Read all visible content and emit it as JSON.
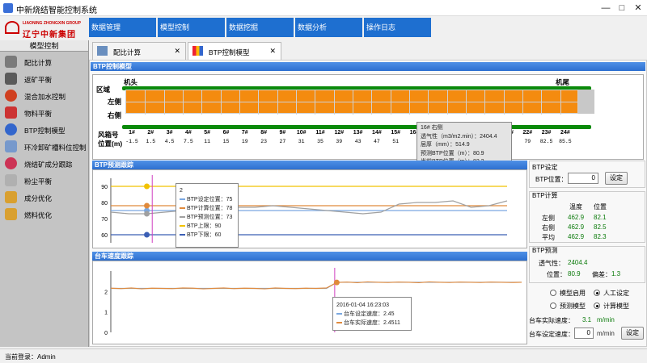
{
  "window": {
    "title": "中新烧结智能控制系统",
    "min": "—",
    "max": "□",
    "close": "✕"
  },
  "logo": {
    "en": "LIAONING ZHONGXIN GROUP",
    "cn": "辽宁中新集团"
  },
  "top_menu": [
    "数据管理",
    "模型控制",
    "数据挖掘",
    "数据分析",
    "操作日志"
  ],
  "sidebar": {
    "header": "模型控制",
    "items": [
      {
        "label": "配比计算",
        "icon": "mix-icon",
        "color": "#7a7a7a"
      },
      {
        "label": "返矿平衡",
        "icon": "balance-icon",
        "color": "#5a5a5a"
      },
      {
        "label": "混合加水控制",
        "icon": "water-icon",
        "color": "#d04020"
      },
      {
        "label": "物料平衡",
        "icon": "material-icon",
        "color": "#cc3333"
      },
      {
        "label": "BTP控制模型",
        "icon": "compass-icon",
        "color": "#3366cc"
      },
      {
        "label": "环冷卸矿槽料位控制",
        "icon": "level-icon",
        "color": "#7799cc"
      },
      {
        "label": "烧结矿成分跟踪",
        "icon": "pie-icon",
        "color": "#cc3355"
      },
      {
        "label": "粉尘平衡",
        "icon": "dust-icon",
        "color": "#b0b0b0"
      },
      {
        "label": "成分优化",
        "icon": "clipboard-icon",
        "color": "#d9a030"
      },
      {
        "label": "燃料优化",
        "icon": "clipboard-icon",
        "color": "#d9a030"
      }
    ]
  },
  "tabs": [
    {
      "label": "配比计算",
      "close": "✕"
    },
    {
      "label": "BTP控制模型",
      "close": "✕"
    }
  ],
  "btp_model": {
    "title": "BTP控制模型",
    "row_label": "区域",
    "head_label": "机头",
    "tail_label": "机尾",
    "left_label": "左侧",
    "right_label": "右侧",
    "box_label": "风箱号",
    "pos_label": "位置(m)",
    "boxes": [
      "1#",
      "2#",
      "3#",
      "4#",
      "5#",
      "6#",
      "7#",
      "8#",
      "9#",
      "10#",
      "11#",
      "12#",
      "13#",
      "14#",
      "15#",
      "16#",
      "17#",
      "18#",
      "19#",
      "20#",
      "21#",
      "22#",
      "23#",
      "24#"
    ],
    "positions": [
      "-1.5",
      "1.5",
      "4.5",
      "7.5",
      "11",
      "15",
      "19",
      "23",
      "27",
      "31",
      "35",
      "39",
      "43",
      "47",
      "51",
      "",
      "",
      "",
      "",
      "",
      "",
      "79",
      "82.5",
      "85.5"
    ],
    "tooltip": {
      "title": "16# 右侧",
      "lines": [
        "透气性（m3/m2.min）：2404.4",
        "层厚（mm）：514.9",
        "预测BTP位置（m）：80.9",
        "当前BTP位置（m）：82.2",
        "预测偏差（m）：1.3"
      ]
    }
  },
  "btp_trace": {
    "title": "BTP预测跟踪",
    "tooltip": {
      "header": "2",
      "lines": [
        "BTP设定位置：75",
        "BTP计算位置：78",
        "BTP预测位置：73",
        "BTP上限：90",
        "BTP下限：60"
      ]
    }
  },
  "speed_trace": {
    "title": "台车速度跟踪",
    "tooltip": {
      "header": "2016-01-04 16:23:03",
      "lines": [
        "台车设定速度：2.45",
        "台车实际速度：2.4511"
      ]
    }
  },
  "chart_data": [
    {
      "type": "line",
      "title": "BTP预测跟踪",
      "ylim": [
        55,
        95
      ],
      "yticks": [
        "90",
        "80",
        "70",
        "60"
      ],
      "x": [
        0,
        1,
        2,
        3,
        4,
        5,
        6,
        7,
        8,
        9,
        10,
        11,
        12,
        13,
        14,
        15,
        16,
        17,
        18,
        19,
        20,
        21,
        22
      ],
      "series": [
        {
          "name": "BTP设定位置",
          "color": "#7aa7e0",
          "values": [
            75,
            75,
            75,
            75,
            75,
            75,
            75,
            75,
            75,
            75,
            75,
            75,
            75,
            75,
            75,
            75,
            75,
            75,
            75,
            75,
            75,
            75,
            75
          ]
        },
        {
          "name": "BTP计算位置",
          "color": "#e08a3c",
          "values": [
            78,
            78,
            78,
            78,
            78,
            78,
            78,
            78,
            78,
            78,
            78,
            78,
            78,
            78,
            78,
            78,
            78,
            78,
            78,
            78,
            78,
            78,
            78
          ]
        },
        {
          "name": "BTP预测位置",
          "color": "#a0a0a0",
          "values": [
            74,
            73,
            73,
            74,
            75,
            76,
            76,
            77,
            77,
            78,
            77,
            76,
            75,
            74,
            73,
            74,
            79,
            80,
            80,
            81,
            77,
            78,
            81
          ]
        },
        {
          "name": "BTP上限",
          "color": "#f2c200",
          "values": [
            90,
            90,
            90,
            90,
            90,
            90,
            90,
            90,
            90,
            90,
            90,
            90,
            90,
            90,
            90,
            90,
            90,
            90,
            90,
            90,
            90,
            90,
            90
          ]
        },
        {
          "name": "BTP下限",
          "color": "#3b5fb5",
          "values": [
            60,
            60,
            60,
            60,
            60,
            60,
            60,
            60,
            60,
            60,
            60,
            60,
            60,
            60,
            60,
            60,
            60,
            60,
            60,
            60,
            60,
            60,
            60
          ]
        }
      ]
    },
    {
      "type": "line",
      "title": "台车速度跟踪",
      "ylim": [
        0,
        3
      ],
      "yticks": [
        "2",
        "1",
        "0"
      ],
      "x": [
        0,
        1,
        2,
        3,
        4,
        5,
        6,
        7,
        8,
        9,
        10,
        11,
        12,
        13,
        14,
        15,
        16,
        17,
        18,
        19,
        20,
        21,
        22,
        23,
        24,
        25,
        26,
        27,
        28,
        29,
        30,
        31,
        32,
        33,
        34,
        35,
        36,
        37,
        38,
        39,
        40
      ],
      "series": [
        {
          "name": "台车设定速度",
          "color": "#7aa7e0",
          "values": [
            2.15,
            2.15,
            2.15,
            2.15,
            2.15,
            2.15,
            2.15,
            2.15,
            2.15,
            2.15,
            2.15,
            2.15,
            2.15,
            2.15,
            2.15,
            2.15,
            2.15,
            2.15,
            2.15,
            2.15,
            2.15,
            2.15,
            2.45,
            2.45,
            2.45,
            2.45,
            2.45,
            2.45,
            2.45,
            2.45,
            2.45,
            2.45,
            2.45,
            2.45,
            2.45,
            2.45,
            2.45,
            2.45,
            2.45,
            2.45,
            2.45
          ]
        },
        {
          "name": "台车实际速度",
          "color": "#e08a3c",
          "values": [
            2.16,
            2.14,
            2.17,
            2.13,
            2.16,
            2.15,
            2.14,
            2.17,
            2.16,
            2.13,
            2.15,
            2.17,
            2.14,
            2.16,
            2.15,
            2.13,
            2.17,
            2.15,
            2.14,
            2.16,
            2.15,
            2.17,
            2.44,
            2.46,
            2.43,
            2.47,
            2.45,
            2.44,
            2.46,
            2.45,
            2.43,
            2.47,
            2.45,
            2.44,
            2.46,
            2.45,
            2.44,
            2.46,
            2.45,
            2.44,
            2.45
          ]
        }
      ]
    }
  ],
  "right_panel": {
    "btp_setting": {
      "title": "BTP设定",
      "label": "BTP位置：",
      "value": "0",
      "button": "设定"
    },
    "btp_calc": {
      "title": "BTP计算",
      "col_temp": "温度",
      "col_pos": "位置",
      "rows": [
        {
          "label": "左侧",
          "temp": "462.9",
          "pos": "82.1"
        },
        {
          "label": "右侧",
          "temp": "462.9",
          "pos": "82.5"
        },
        {
          "label": "平均",
          "temp": "462.9",
          "pos": "82.3"
        }
      ]
    },
    "btp_predict": {
      "title": "BTP预测",
      "perm_label": "透气性：",
      "perm_value": "2404.4",
      "pos_label": "位置：",
      "pos_value": "80.9",
      "dev_label": "偏差：",
      "dev_value": "1.3"
    },
    "radios": [
      {
        "label": "模型启用",
        "checked": false
      },
      {
        "label": "人工设定",
        "checked": true
      },
      {
        "label": "预测模型",
        "checked": false
      },
      {
        "label": "计算模型",
        "checked": true
      }
    ],
    "actual_speed_label": "台车实际速度：",
    "actual_speed_value": "3.1",
    "speed_unit": "m/min",
    "set_speed_label": "台车设定速度：",
    "set_speed_value": "0",
    "set_button": "设定"
  },
  "status": {
    "text": "当前登录：Admin"
  }
}
